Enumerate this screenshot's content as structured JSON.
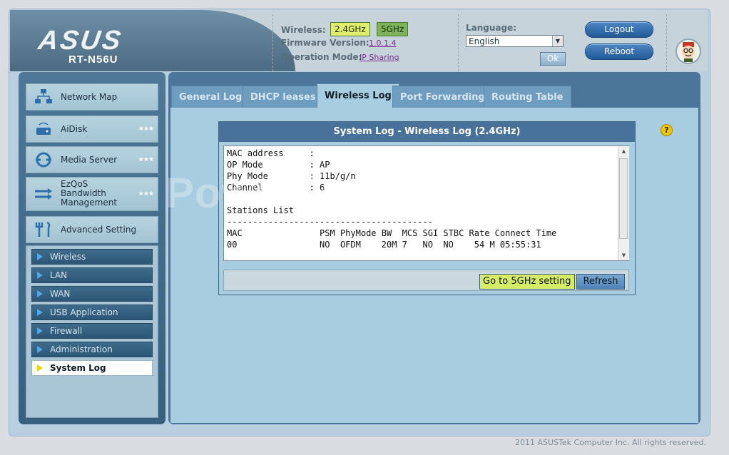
{
  "header": {
    "brand": "ASUS",
    "model": "RT-N56U",
    "wireless_label": "Wireless:",
    "band_24": "2.4GHz",
    "band_5": "5GHz",
    "firmware_label": "Firmware Version:",
    "firmware_value": "1.0.1.4",
    "opmode_label": "Operation Mode:",
    "opmode_value": "IP Sharing",
    "language_label": "Language:",
    "language_value": "English",
    "ok_label": "Ok",
    "logout_label": "Logout",
    "reboot_label": "Reboot"
  },
  "sidebar": {
    "items": [
      {
        "label": "Network Map",
        "icon": "network-map-icon"
      },
      {
        "label": "AiDisk",
        "icon": "disk-icon"
      },
      {
        "label": "Media Server",
        "icon": "media-server-icon"
      },
      {
        "label": "EzQoS Bandwidth Management",
        "line1": "EzQoS",
        "line2": "Bandwidth",
        "line3": "Management",
        "icon": "qos-icon"
      },
      {
        "label": "Advanced Setting",
        "icon": "tools-icon"
      }
    ],
    "stars": "★★★",
    "subitems": [
      "Wireless",
      "LAN",
      "WAN",
      "USB Application",
      "Firewall",
      "Administration",
      "System Log"
    ],
    "active_subitem": "System Log"
  },
  "tabs": [
    "General Log",
    "DHCP leases",
    "Wireless Log",
    "Port Forwarding",
    "Routing Table"
  ],
  "active_tab": "Wireless Log",
  "log": {
    "title": "System Log - Wireless Log (2.4GHz)",
    "lines": [
      "MAC address     :",
      "OP Mode         : AP",
      "Phy Mode        : 11b/g/n",
      "Channel         : 6",
      "",
      "Stations List",
      "----------------------------------------",
      "MAC               PSM PhyMode BW  MCS SGI STBC Rate Connect Time",
      "00                NO  OFDM    20M 7   NO  NO    54 M 05:55:31"
    ]
  },
  "buttons": {
    "go_5ghz": "Go to 5GHz setting",
    "refresh": "Refresh"
  },
  "watermark": "PowinTech.com",
  "footer": "2011 ASUSTek Computer Inc. All rights reserved.",
  "colors": {
    "accent_green": "#d6ec66",
    "header_blue": "#48729a",
    "content_bg": "#a9cde0"
  }
}
